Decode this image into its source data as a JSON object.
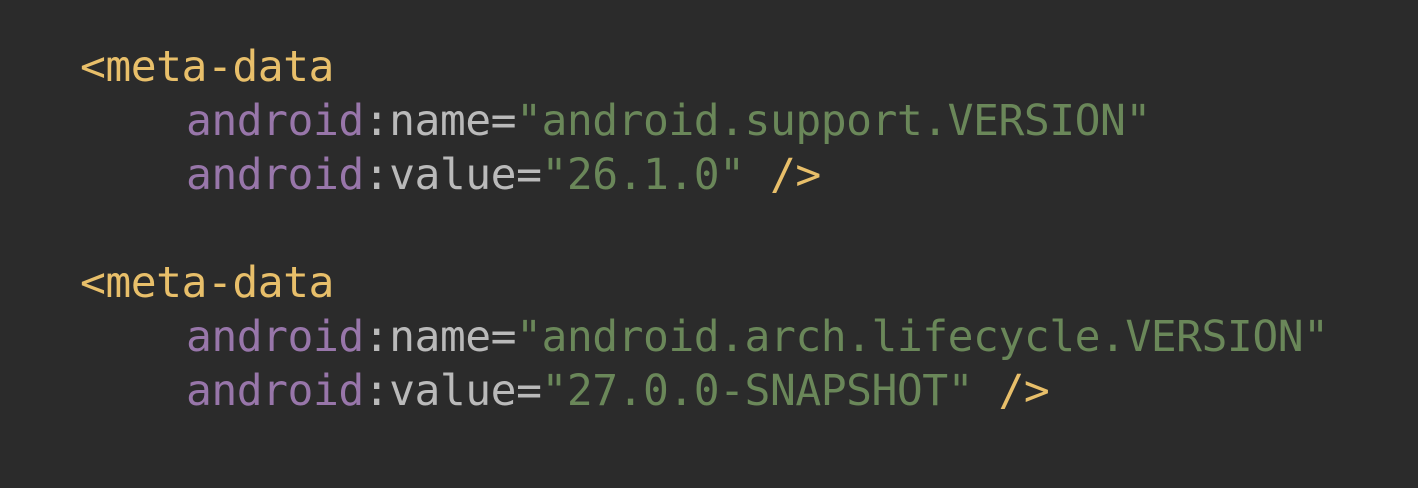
{
  "colors": {
    "background": "#2b2b2b",
    "tag": "#e8bf6a",
    "namespace": "#9876aa",
    "attribute": "#bababa",
    "string": "#6a8759"
  },
  "blocks": [
    {
      "open_tag": "<meta-data",
      "attrs": [
        {
          "ns": "android",
          "colon": ":",
          "name": "name",
          "eq": "=",
          "value": "\"android.support.VERSION\""
        },
        {
          "ns": "android",
          "colon": ":",
          "name": "value",
          "eq": "=",
          "value": "\"26.1.0\""
        }
      ],
      "close_tag": "/>"
    },
    {
      "open_tag": "<meta-data",
      "attrs": [
        {
          "ns": "android",
          "colon": ":",
          "name": "name",
          "eq": "=",
          "value": "\"android.arch.lifecycle.VERSION\""
        },
        {
          "ns": "android",
          "colon": ":",
          "name": "value",
          "eq": "=",
          "value": "\"27.0.0-SNAPSHOT\""
        }
      ],
      "close_tag": "/>"
    }
  ]
}
